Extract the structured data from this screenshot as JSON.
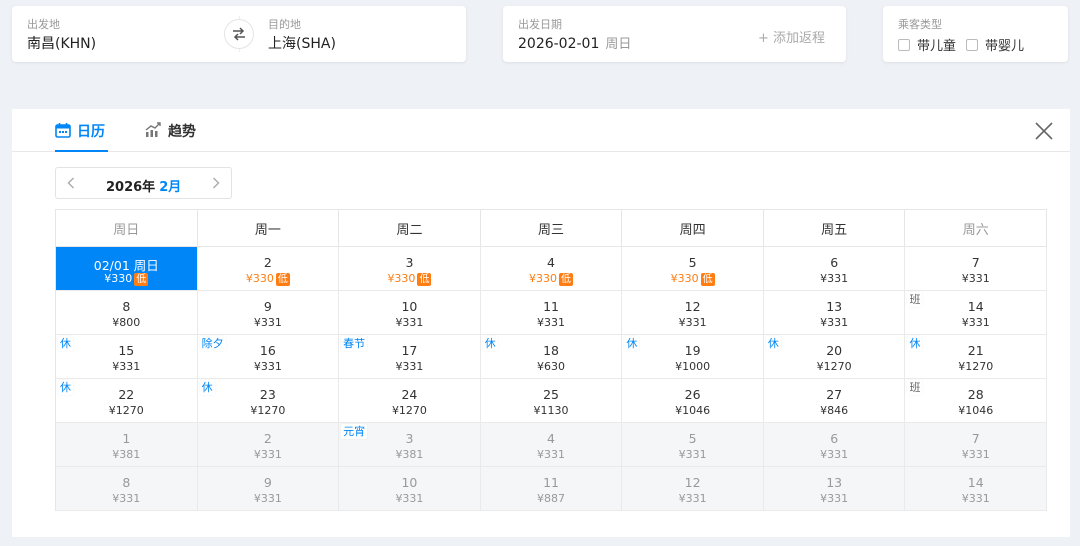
{
  "search": {
    "from_label": "出发地",
    "from_value": "南昌(KHN)",
    "to_label": "目的地",
    "to_value": "上海(SHA)",
    "date_label": "出发日期",
    "date_value": "2026-02-01",
    "date_weekday": "周日",
    "add_return": "+ 添加返程",
    "pax_label": "乘客类型",
    "child_label": "带儿童",
    "infant_label": "带婴儿"
  },
  "calendar": {
    "tabs": {
      "calendar": "日历",
      "trend": "趋势"
    },
    "year": "2026年",
    "month": "2月",
    "weekdays": [
      "周日",
      "周一",
      "周二",
      "周三",
      "周四",
      "周五",
      "周六"
    ],
    "weeks": [
      [
        {
          "day": "02/01 周日",
          "price": "¥330",
          "low": "低",
          "state": "selected"
        },
        {
          "day": "2",
          "price": "¥330",
          "low": "低"
        },
        {
          "day": "3",
          "price": "¥330",
          "low": "低"
        },
        {
          "day": "4",
          "price": "¥330",
          "low": "低"
        },
        {
          "day": "5",
          "price": "¥330",
          "low": "低"
        },
        {
          "day": "6",
          "price": "¥331"
        },
        {
          "day": "7",
          "price": "¥331"
        }
      ],
      [
        {
          "day": "8",
          "price": "¥800"
        },
        {
          "day": "9",
          "price": "¥331"
        },
        {
          "day": "10",
          "price": "¥331"
        },
        {
          "day": "11",
          "price": "¥331"
        },
        {
          "day": "12",
          "price": "¥331"
        },
        {
          "day": "13",
          "price": "¥331"
        },
        {
          "day": "14",
          "price": "¥331",
          "tag": "班",
          "tag_type": "work"
        }
      ],
      [
        {
          "day": "15",
          "price": "¥331",
          "tag": "休"
        },
        {
          "day": "16",
          "price": "¥331",
          "tag": "除夕"
        },
        {
          "day": "17",
          "price": "¥331",
          "tag": "春节"
        },
        {
          "day": "18",
          "price": "¥630",
          "tag": "休"
        },
        {
          "day": "19",
          "price": "¥1000",
          "tag": "休"
        },
        {
          "day": "20",
          "price": "¥1270",
          "tag": "休"
        },
        {
          "day": "21",
          "price": "¥1270",
          "tag": "休"
        }
      ],
      [
        {
          "day": "22",
          "price": "¥1270",
          "tag": "休"
        },
        {
          "day": "23",
          "price": "¥1270",
          "tag": "休"
        },
        {
          "day": "24",
          "price": "¥1270"
        },
        {
          "day": "25",
          "price": "¥1130"
        },
        {
          "day": "26",
          "price": "¥1046"
        },
        {
          "day": "27",
          "price": "¥846"
        },
        {
          "day": "28",
          "price": "¥1046",
          "tag": "班",
          "tag_type": "work"
        }
      ],
      [
        {
          "day": "1",
          "price": "¥381",
          "state": "next"
        },
        {
          "day": "2",
          "price": "¥331",
          "state": "next"
        },
        {
          "day": "3",
          "price": "¥381",
          "state": "next",
          "tag": "元宵"
        },
        {
          "day": "4",
          "price": "¥331",
          "state": "next"
        },
        {
          "day": "5",
          "price": "¥331",
          "state": "next"
        },
        {
          "day": "6",
          "price": "¥331",
          "state": "next"
        },
        {
          "day": "7",
          "price": "¥331",
          "state": "next"
        }
      ],
      [
        {
          "day": "8",
          "price": "¥331",
          "state": "next"
        },
        {
          "day": "9",
          "price": "¥331",
          "state": "next"
        },
        {
          "day": "10",
          "price": "¥331",
          "state": "next"
        },
        {
          "day": "11",
          "price": "¥887",
          "state": "next"
        },
        {
          "day": "12",
          "price": "¥331",
          "state": "next"
        },
        {
          "day": "13",
          "price": "¥331",
          "state": "next"
        },
        {
          "day": "14",
          "price": "¥331",
          "state": "next"
        }
      ]
    ]
  },
  "colors": {
    "accent": "#0086f6",
    "low_price": "#ff7d13"
  },
  "icons": {
    "swap": "swap-arrows-icon",
    "calendar": "calendar-icon",
    "trend": "trend-chart-icon",
    "close": "close-icon",
    "prev": "chevron-left-icon",
    "next": "chevron-right-icon"
  }
}
